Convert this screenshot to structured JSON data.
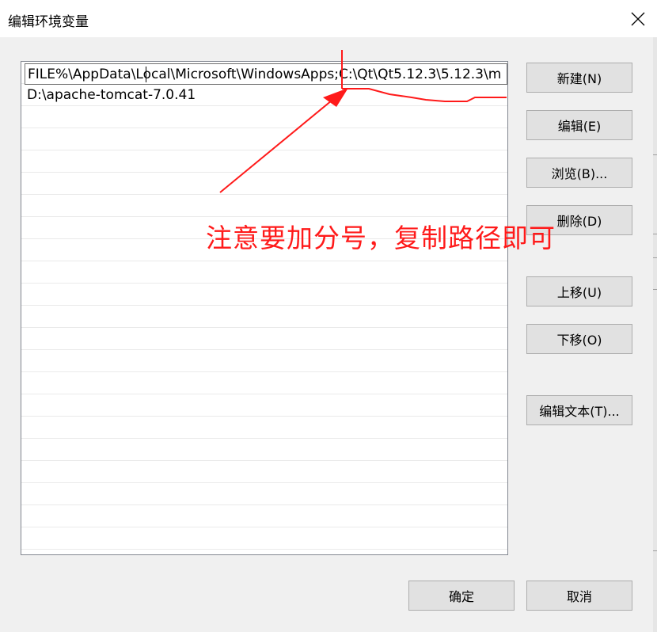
{
  "window": {
    "title": "编辑环境变量",
    "close_icon": "close-icon"
  },
  "list": {
    "items": [
      {
        "label": "FILE%\\AppData\\Local\\Microsoft\\WindowsApps;C:\\Qt\\Qt5.12.3\\5.12.3\\m",
        "editing": true
      },
      {
        "label": "D:\\apache-tomcat-7.0.41",
        "editing": false
      }
    ]
  },
  "buttons": {
    "new": "新建(N)",
    "edit": "编辑(E)",
    "browse": "浏览(B)...",
    "delete": "删除(D)",
    "move_up": "上移(U)",
    "move_down": "下移(O)",
    "edit_text": "编辑文本(T)...",
    "ok": "确定",
    "cancel": "取消"
  },
  "annotation": {
    "text": "注意要加分号，复制路径即可",
    "color": "#ff1a1a"
  },
  "colors": {
    "button_face": "#e1e1e1",
    "button_border": "#adadad",
    "dialog_background": "#f0f0f0"
  }
}
